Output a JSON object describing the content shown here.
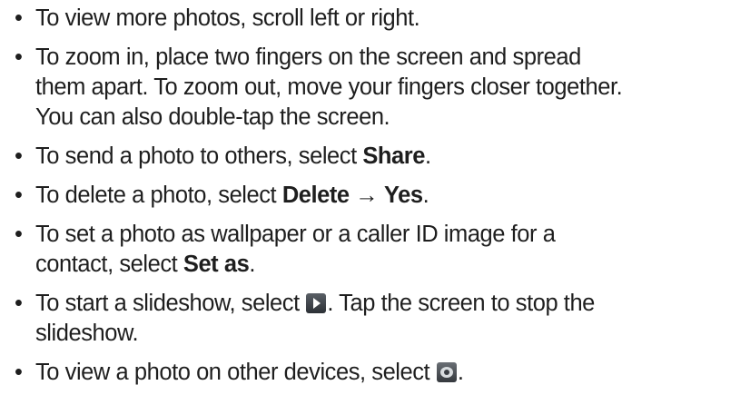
{
  "bullet_glyph": "•",
  "items": [
    {
      "text": "To view more photos, scroll left or right."
    },
    {
      "line1": "To zoom in, place two fingers on the screen and spread",
      "line2": "them apart. To zoom out, move your fingers closer together.",
      "line3": "You can also double-tap the screen."
    },
    {
      "before": "To send a photo to others, select ",
      "bold": "Share",
      "after": "."
    },
    {
      "before": "To delete a photo, select ",
      "bold1": "Delete",
      "arrow": " → ",
      "bold2": "Yes",
      "after": "."
    },
    {
      "line1": "To set a photo as wallpaper or a caller ID image for a",
      "line2_before": "contact, select ",
      "bold": "Set as",
      "after": "."
    },
    {
      "before": "To start a slideshow, select ",
      "icon": "play-icon",
      "after": ". Tap the screen to stop the",
      "line2": "slideshow."
    },
    {
      "before": "To view a photo on other devices, select ",
      "icon": "share-to-devices-icon",
      "after": "."
    }
  ]
}
